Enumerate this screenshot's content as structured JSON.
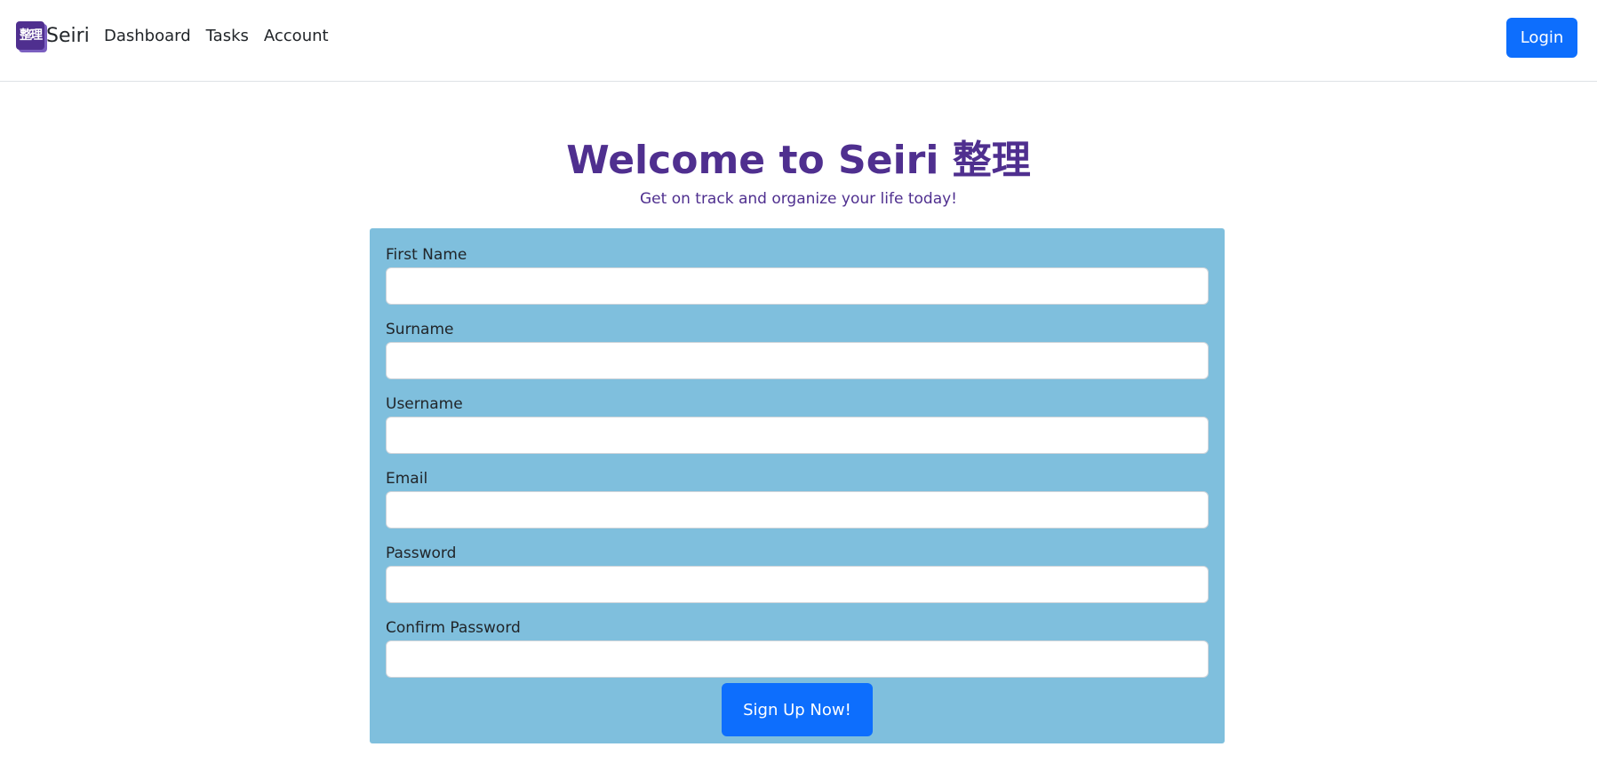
{
  "brand": {
    "logo_text": "整理",
    "name": "Seiri"
  },
  "nav": {
    "items": [
      {
        "label": "Dashboard"
      },
      {
        "label": "Tasks"
      },
      {
        "label": "Account"
      }
    ],
    "login_label": "Login"
  },
  "hero": {
    "title": "Welcome to Seiri 整理",
    "subtitle": "Get on track and organize your life today!"
  },
  "form": {
    "fields": [
      {
        "label": "First Name",
        "value": ""
      },
      {
        "label": "Surname",
        "value": ""
      },
      {
        "label": "Username",
        "value": ""
      },
      {
        "label": "Email",
        "value": ""
      },
      {
        "label": "Password",
        "value": ""
      },
      {
        "label": "Confirm Password",
        "value": ""
      }
    ],
    "submit_label": "Sign Up Now!"
  },
  "colors": {
    "accent": "#4f2f8f",
    "primary_button": "#0d6efd",
    "card_background": "#7fbfdd"
  }
}
